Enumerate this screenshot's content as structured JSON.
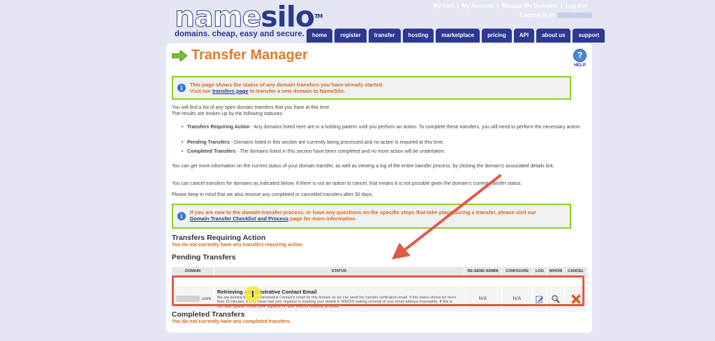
{
  "logo": {
    "word_a": "name",
    "word_b": "silo",
    "tm": "TM",
    "tagline": "domains. cheap, easy and secure."
  },
  "toplinks": [
    "My Cart",
    "My Account",
    "Manage My Domains",
    "Log Out"
  ],
  "logged_in": "Logged in as",
  "nav": [
    "home",
    "register",
    "transfer",
    "hosting",
    "marketplace",
    "pricing",
    "API",
    "about us",
    "support"
  ],
  "page": {
    "title": "Transfer Manager",
    "help": "HELP"
  },
  "notice1": {
    "line1": "This page shows the status of any domain transfers you have already started.",
    "pre": "Visit our ",
    "link": "transfers page",
    "post": " to transfer a new domain to NameSilo."
  },
  "intro": {
    "p1": "You will find a list of any open domain transfers that you have at this time.",
    "p2": "The results are broken up by the following statuses:"
  },
  "bullets": [
    {
      "label": "Transfers Requiring Action",
      "text": " - Any domains listed here are in a holding pattern until you perform an action. To complete these transfers, you will need to perform the necessary action."
    },
    {
      "label": "Pending Transfers",
      "text": " - Domains listed in this section are currently being processed and no action is required at this time."
    },
    {
      "label": "Completed Transfers",
      "text": " - The domains listed in this section have been completed and no more action will be undertaken."
    }
  ],
  "info": {
    "p1": "You can get more information on the current status of your domain transfer, as well as viewing a log of the entire transfer process, by clicking the domain's associated details link.",
    "p2": "You can cancel transfers for domains as indicated below. If there is not an option to cancel, that means it is not possible given the domain's current transfer status.",
    "p3": "Please keep in mind that we also remove any completed or cancelled transfers after 30 days."
  },
  "notice2": {
    "line1": "If you are new to the domain transfer process, or have any questions on the specific steps that take place during a transfer, please visit our",
    "link": "Domain Transfer Checklist and Process",
    "post": " page for more information."
  },
  "sections": {
    "requiring": {
      "title": "Transfers Requiring Action",
      "msg": "You do not currently have any transfers requiring action."
    },
    "pending": {
      "title": "Pending Transfers"
    },
    "completed": {
      "title": "Completed Transfers",
      "msg": "You do not currently have any completed transfers."
    }
  },
  "table": {
    "headers": [
      "DOMAIN",
      "STATUS",
      "RE-SEND ADMIN EMAIL",
      "CONFIGURE",
      "LOG",
      "WHOIS",
      "CANCEL"
    ],
    "row": {
      "domain_suffix": ".com",
      "status_title": "Retrieving Administrative Contact Email",
      "status_desc": "We are looking for the Administrative Contact's email for this domain so we can send the transfer verification email. If this status shows for more than 15 minutes, it may mean that your registrar is masking your details in WHOIS making retrieval of your email address impossible. If this is the case, please contact your registrar to have WHOIS masking removed.",
      "resend": "N/A",
      "configure": "N/A"
    }
  },
  "colors": {
    "accent": "#e07b28",
    "nav": "#2b3990",
    "highlight": "#e05a4a",
    "notice_border": "#8ccf2a"
  }
}
